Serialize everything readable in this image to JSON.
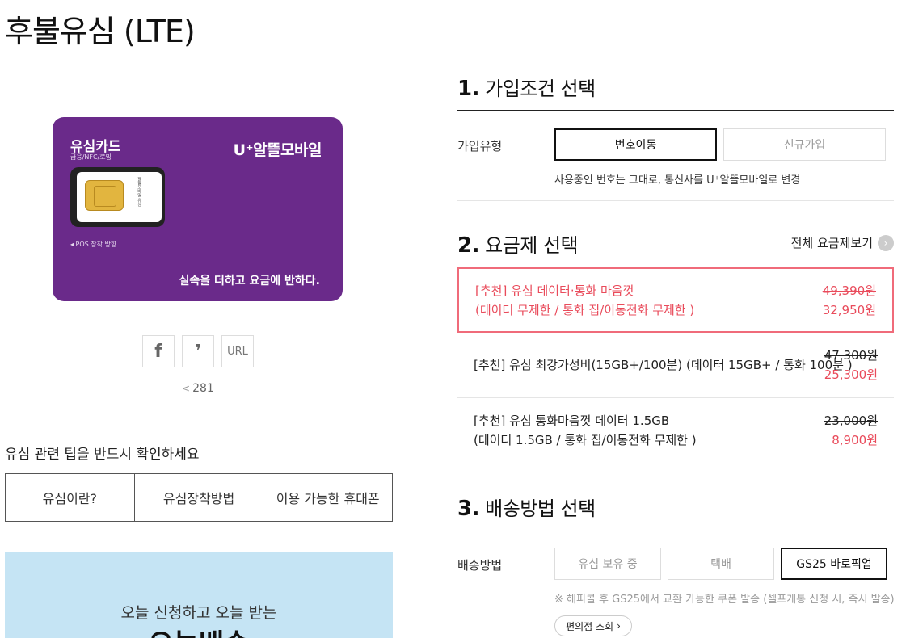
{
  "page": {
    "title": "후불유심 (LTE)"
  },
  "sim_card": {
    "title": "유심카드",
    "subtitle": "금융/NFC/로밍",
    "brand": "U⁺알뜰모바일",
    "pos_label": "◂ POS 장착 방향",
    "slogan": "실속을 더하고 요금에 반하다.",
    "chip_text": "알뜰모바일 유심"
  },
  "share": {
    "facebook_label": "f",
    "kakao_label": "❜",
    "url_label": "URL",
    "count": "281"
  },
  "tips": {
    "title": "유심 관련 팁을 반드시 확인하세요",
    "items": [
      "유심이란?",
      "유심장착방법",
      "이용 가능한 휴대폰"
    ]
  },
  "banner": {
    "line1": "오늘 신청하고 오늘 받는",
    "line2": "오늘배송"
  },
  "section1": {
    "number": "1.",
    "title": "가입조건 선택",
    "row_label": "가입유형",
    "options": [
      "번호이동",
      "신규가입"
    ],
    "selected": "번호이동",
    "description": "사용중인 번호는 그대로, 통신사를 U⁺알뜰모바일로 변경"
  },
  "section2": {
    "number": "2.",
    "title": "요금제 선택",
    "view_all": "전체 요금제보기",
    "plans": [
      {
        "line1": "[추천] 유심 데이터·통화 마음껏",
        "line2": "(데이터 무제한 / 통화 집/이동전화 무제한 )",
        "old_price": "49,390원",
        "new_price": "32,950원",
        "selected": true
      },
      {
        "line1": "[추천] 유심 최강가성비(15GB+/100분) (데이터 15GB+ / 통화 100분 )",
        "line2": "",
        "old_price": "47,300원",
        "new_price": "25,300원",
        "selected": false
      },
      {
        "line1": "[추천] 유심 통화마음껏 데이터 1.5GB",
        "line2": "(데이터 1.5GB / 통화 집/이동전화 무제한 )",
        "old_price": "23,000원",
        "new_price": "8,900원",
        "selected": false
      }
    ]
  },
  "section3": {
    "number": "3.",
    "title": "배송방법 선택",
    "row_label": "배송방법",
    "options": [
      "유심 보유 중",
      "택배",
      "GS25 바로픽업"
    ],
    "selected": "GS25 바로픽업",
    "note": "※ 해피콜 후 GS25에서 교환 가능한 쿠폰 발송 (셀프개통 신청 시, 즉시 발송)",
    "store_button": "편의점 조회"
  },
  "colors": {
    "accent": "#e94b5b",
    "card_purple": "#6a2a8a",
    "banner_blue": "#c5e4f4"
  }
}
